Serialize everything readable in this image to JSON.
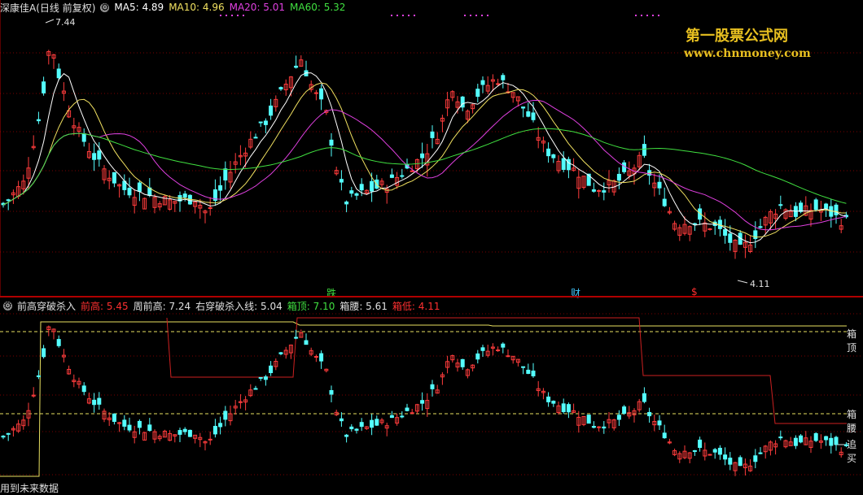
{
  "main": {
    "stock_name": "深康佳A",
    "period": "(日线 前复权)",
    "ma": [
      {
        "label": "MA5: 4.89",
        "color": "#ffffff"
      },
      {
        "label": "MA10: 4.96",
        "color": "#f0e060"
      },
      {
        "label": "MA20: 5.01",
        "color": "#e040e0"
      },
      {
        "label": "MA60: 5.32",
        "color": "#40e040"
      }
    ],
    "high_label": "7.44",
    "low_label": "4.11",
    "markers": [
      {
        "text": "跌",
        "color": "#40e040"
      },
      {
        "text": "财",
        "color": "#40c8ff"
      },
      {
        "text": "$",
        "color": "#ff3030"
      }
    ]
  },
  "indicator": {
    "name": "前高穿破杀入",
    "items": [
      {
        "label": "前高: 5.45",
        "color": "#ff3030"
      },
      {
        "label": "周前高: 7.24",
        "color": "#e0e0e0"
      },
      {
        "label": "右穿破杀入线: 5.04",
        "color": "#e0e0e0"
      },
      {
        "label": "箱顶: 7.10",
        "color": "#40e040"
      },
      {
        "label": "箱腰: 5.61",
        "color": "#e0e0e0"
      },
      {
        "label": "箱低: 4.11",
        "color": "#ff3030"
      }
    ],
    "right_labels": [
      "箱顶",
      "箱腰",
      "追买"
    ],
    "bottom_text": "用到未来数据"
  },
  "watermark": {
    "line1": "第一股票公式网",
    "line2": "www.chnmoney.com"
  },
  "colors": {
    "up": "#ff3c3c",
    "down": "#54ffff",
    "grid": "#7a0000"
  }
}
